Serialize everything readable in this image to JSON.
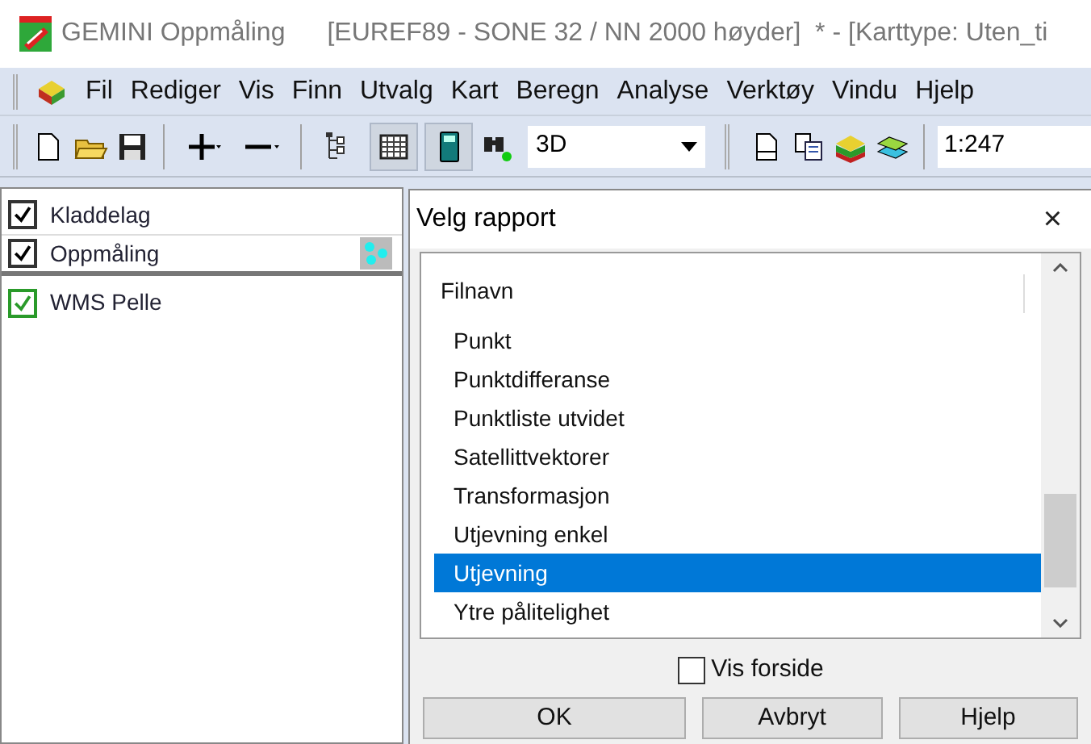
{
  "window": {
    "app_title": "GEMINI Oppmåling",
    "document_title": "[EUREF89 - SONE 32 / NN 2000 høyder]  * - [Karttype: Uten_ti"
  },
  "menu": [
    "Fil",
    "Rediger",
    "Vis",
    "Finn",
    "Utvalg",
    "Kart",
    "Beregn",
    "Analyse",
    "Verktøy",
    "Vindu",
    "Hjelp"
  ],
  "toolbar": {
    "view_combo": "3D",
    "scale_field": "1:247",
    "toggles": [
      {
        "selected": false
      },
      {
        "selected": true
      },
      {
        "selected": true
      }
    ]
  },
  "layers": [
    {
      "name": "Kladdelag",
      "checked": true,
      "kind": "plain"
    },
    {
      "name": "Oppmåling",
      "checked": true,
      "kind": "survey"
    },
    {
      "name": "WMS Pelle",
      "checked": true,
      "kind": "wms"
    }
  ],
  "dialog": {
    "title": "Velg rapport",
    "close": "×",
    "header": "Filnavn",
    "items": [
      {
        "label": "Punkt",
        "selected": false
      },
      {
        "label": "Punktdifferanse",
        "selected": false
      },
      {
        "label": "Punktliste utvidet",
        "selected": false
      },
      {
        "label": "Satellittvektorer",
        "selected": false
      },
      {
        "label": "Transformasjon",
        "selected": false
      },
      {
        "label": "Utjevning enkel",
        "selected": false
      },
      {
        "label": "Utjevning",
        "selected": true
      },
      {
        "label": "Ytre pålitelighet",
        "selected": false
      }
    ],
    "show_cover": {
      "label": "Vis forside",
      "checked": false
    },
    "buttons": [
      "OK",
      "Avbryt",
      "Hjelp"
    ]
  }
}
